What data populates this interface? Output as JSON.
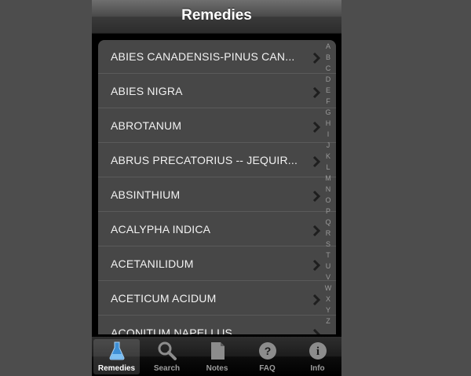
{
  "navbar": {
    "title": "Remedies"
  },
  "remedies": [
    "ABIES CANADENSIS-PINUS CAN...",
    "ABIES NIGRA",
    "ABROTANUM",
    "ABRUS PRECATORIUS -- JEQUIR...",
    "ABSINTHIUM",
    "ACALYPHA INDICA",
    "ACETANILIDUM",
    "ACETICUM ACIDUM",
    "ACONITUM NAPELLUS"
  ],
  "index_letters": [
    "A",
    "B",
    "C",
    "D",
    "E",
    "F",
    "G",
    "H",
    "I",
    "J",
    "K",
    "L",
    "M",
    "N",
    "O",
    "P",
    "Q",
    "R",
    "S",
    "T",
    "U",
    "V",
    "W",
    "X",
    "Y",
    "Z"
  ],
  "tabs": [
    {
      "label": "Remedies",
      "icon": "flask-icon",
      "selected": true
    },
    {
      "label": "Search",
      "icon": "magnifier-icon",
      "selected": false
    },
    {
      "label": "Notes",
      "icon": "note-icon",
      "selected": false
    },
    {
      "label": "FAQ",
      "icon": "question-icon",
      "selected": false
    },
    {
      "label": "Info",
      "icon": "info-icon",
      "selected": false
    }
  ],
  "colors": {
    "background": "#4d4d4d",
    "list_background": "#474747",
    "text": "#f2f2f2",
    "accent_blue": "#3d8fd6"
  }
}
